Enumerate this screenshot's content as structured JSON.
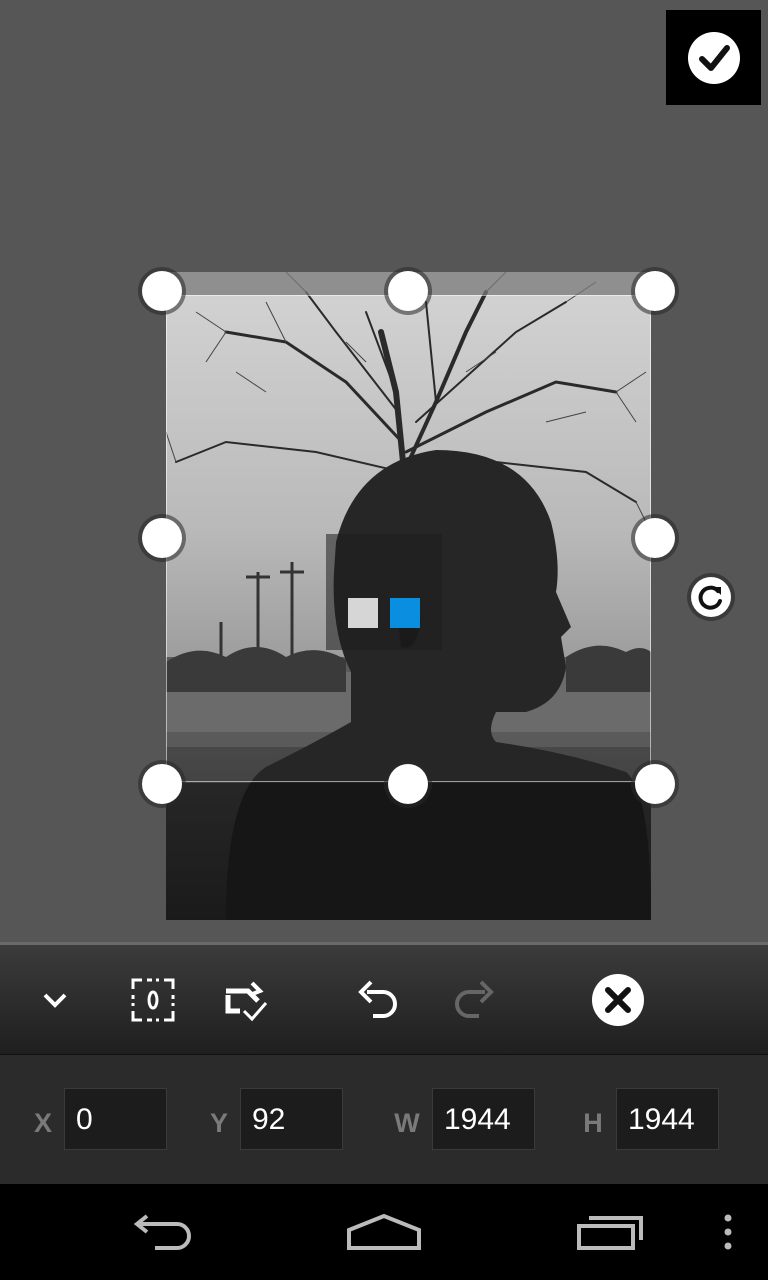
{
  "crop_editor": {
    "rotate_icon": "rotate-clockwise-icon",
    "aspect_options": [
      "free",
      "selected"
    ],
    "colors": {
      "accent": "#0a8ee0",
      "handle": "#ffffff",
      "background": "#565656"
    }
  },
  "toolbar": {
    "collapse_icon": "chevron-down-icon",
    "auto_fit_icon": "focus-frame-icon",
    "rotate_apply_icon": "rotate-check-icon",
    "undo_icon": "undo-icon",
    "redo_icon": "redo-icon",
    "cancel_icon": "close-circle-icon",
    "confirm_icon": "checkmark-icon"
  },
  "coordinates": {
    "x_label": "X",
    "x_value": "0",
    "y_label": "Y",
    "y_value": "92",
    "w_label": "W",
    "w_value": "1944",
    "h_label": "H",
    "h_value": "1944"
  },
  "nav": {
    "back_icon": "back-icon",
    "home_icon": "home-icon",
    "recents_icon": "recent-apps-icon",
    "menu_icon": "overflow-menu-icon"
  }
}
